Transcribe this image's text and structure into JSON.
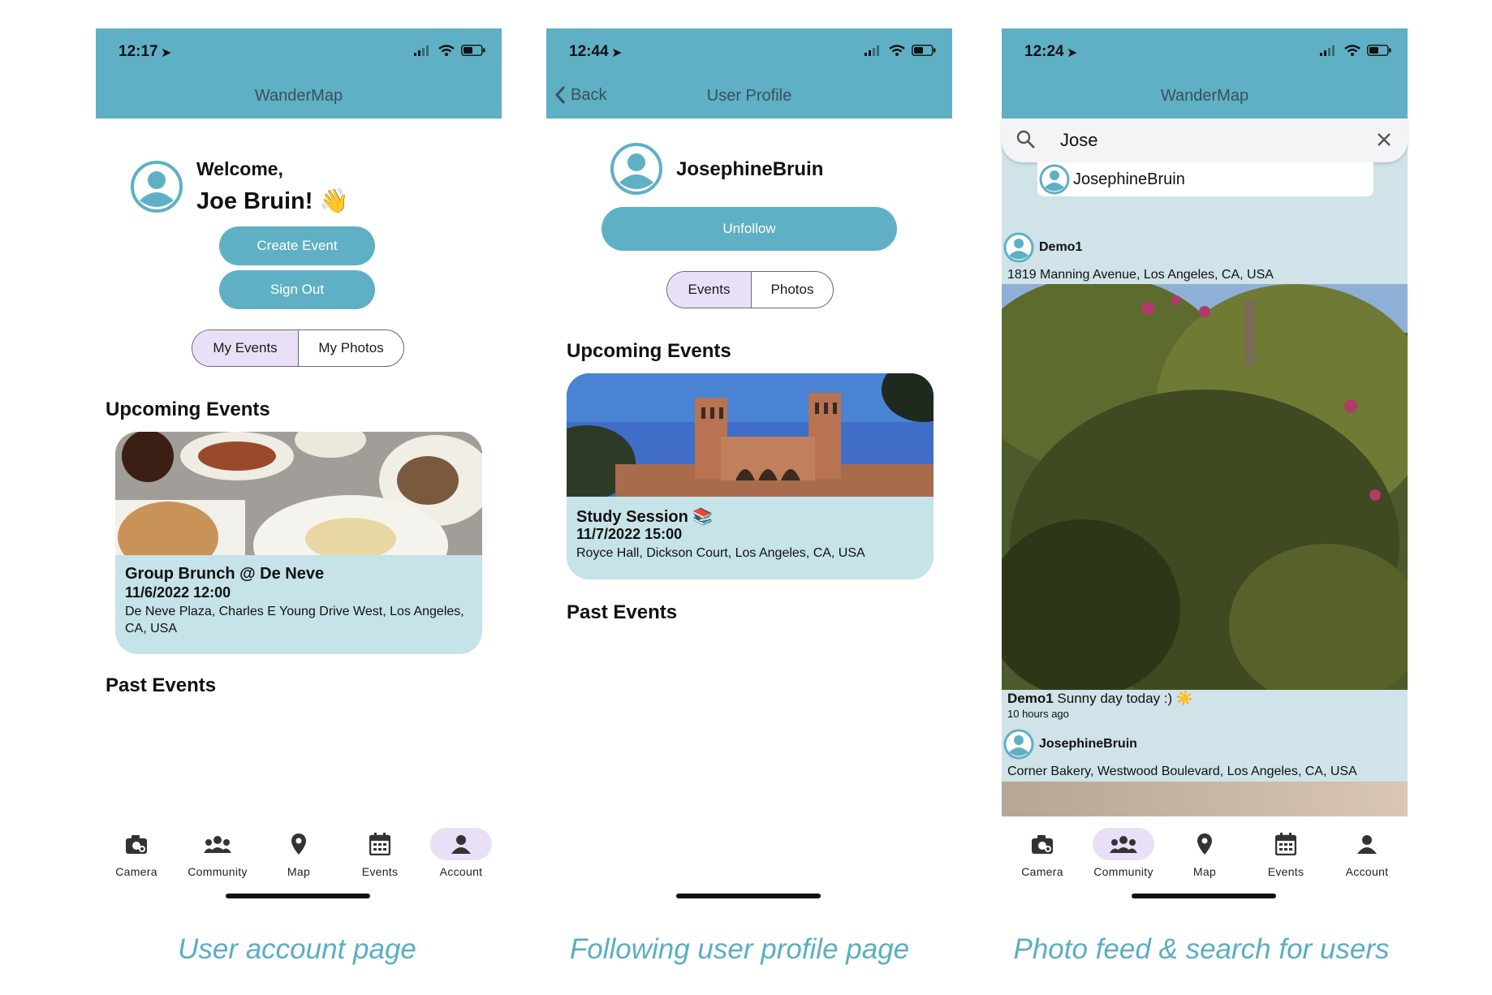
{
  "status_bar": {
    "panel1_time": "12:17",
    "panel2_time": "12:44",
    "panel3_time": "12:24"
  },
  "colors": {
    "header": "#5fb0c5",
    "card": "#c5e3e8",
    "segment_active": "#e9e0f7",
    "caption": "#5aaec4"
  },
  "account_page": {
    "title": "WanderMap",
    "welcome_line": "Welcome,",
    "name_line": "Joe Bruin! 👋",
    "create_event_label": "Create Event",
    "sign_out_label": "Sign Out",
    "tabs": [
      "My Events",
      "My Photos"
    ],
    "upcoming_heading": "Upcoming Events",
    "event": {
      "title": "Group Brunch @ De Neve",
      "datetime": "11/6/2022 12:00",
      "location": "De Neve Plaza, Charles E Young Drive West, Los Angeles, CA, USA"
    },
    "past_heading": "Past Events",
    "caption": "User account page"
  },
  "profile_page": {
    "back_label": "Back",
    "title": "User Profile",
    "username": "JosephineBruin",
    "unfollow_label": "Unfollow",
    "tabs": [
      "Events",
      "Photos"
    ],
    "upcoming_heading": "Upcoming Events",
    "event": {
      "title": "Study Session 📚",
      "datetime": "11/7/2022 15:00",
      "location": "Royce Hall, Dickson Court, Los Angeles, CA, USA"
    },
    "past_heading": "Past Events",
    "caption": "Following user profile page"
  },
  "feed_page": {
    "title": "WanderMap",
    "search_query": "Jose",
    "suggestion": "JosephineBruin",
    "posts": [
      {
        "user": "Demo1",
        "location": "1819 Manning Avenue, Los Angeles, CA, USA",
        "caption_text": "Sunny day today :) ☀️",
        "time_ago": "10 hours ago"
      },
      {
        "user": "JosephineBruin",
        "location": "Corner Bakery, Westwood Boulevard, Los Angeles, CA, USA"
      }
    ],
    "caption": "Photo feed & search for users"
  },
  "nav": {
    "items": [
      "Camera",
      "Community",
      "Map",
      "Events",
      "Account"
    ],
    "icons": [
      "camera-icon",
      "community-icon",
      "map-pin-icon",
      "calendar-icon",
      "account-icon"
    ],
    "active_panel1": "Account",
    "active_panel3": "Community"
  }
}
